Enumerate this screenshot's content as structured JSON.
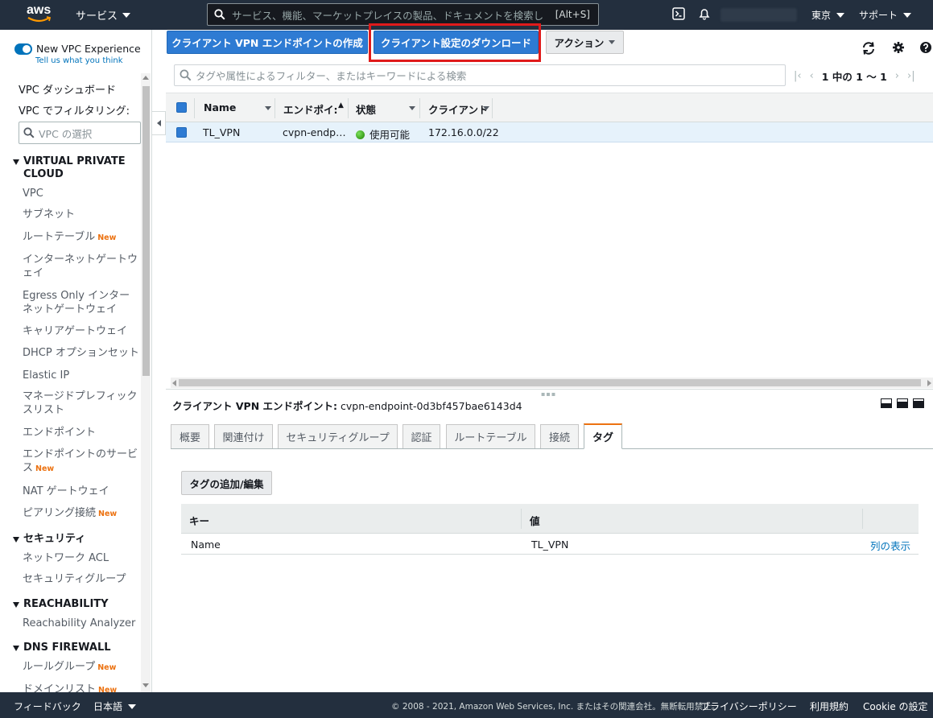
{
  "nav": {
    "logo_text": "aws",
    "services_label": "サービス",
    "search_placeholder": "サービス、機能、マーケットプレイスの製品、ドキュメントを検索し",
    "search_shortcut": "[Alt+S]",
    "region_label": "東京",
    "support_label": "サポート"
  },
  "sidebar": {
    "toggle_label": "New VPC Experience",
    "tell_us": "Tell us what you think",
    "dashboard": "VPC ダッシュボード",
    "filter_label": "VPC でフィルタリング:",
    "vpc_select_placeholder": "VPC の選択",
    "new_badge": "New",
    "sections": {
      "vpc": "VIRTUAL PRIVATE CLOUD",
      "security": "セキュリティ",
      "reachability": "REACHABILITY",
      "dns_firewall": "DNS FIREWALL"
    },
    "items": {
      "vpc": "VPC",
      "subnet": "サブネット",
      "route_table": "ルートテーブル",
      "igw": "インターネットゲートウェイ",
      "egress_only": "Egress Only インターネットゲートウェイ",
      "carrier_gw": "キャリアゲートウェイ",
      "dhcp": "DHCP オプションセット",
      "elastic_ip": "Elastic IP",
      "prefix_list": "マネージドプレフィックスリスト",
      "endpoint": "エンドポイント",
      "endpoint_service": "エンドポイントのサービス",
      "nat_gw": "NAT ゲートウェイ",
      "peering": "ピアリング接続",
      "network_acl": "ネットワーク ACL",
      "security_group": "セキュリティグループ",
      "reachability_analyzer": "Reachability Analyzer",
      "rule_group": "ルールグループ",
      "domain_list": "ドメインリスト"
    }
  },
  "toolbar": {
    "create_label": "クライアント VPN エンドポイントの作成",
    "download_label": "クライアント設定のダウンロード",
    "actions_label": "アクション"
  },
  "filter": {
    "placeholder": "タグや属性によるフィルター、またはキーワードによる検索"
  },
  "pager": {
    "text": "1 中の 1 ～ 1"
  },
  "grid": {
    "columns": [
      "Name",
      "エンドポイ:",
      "状態",
      "クライアント"
    ],
    "row": {
      "name": "TL_VPN",
      "endpoint": "cvpn-endp…",
      "state": "使用可能",
      "client": "172.16.0.0/22"
    }
  },
  "detail": {
    "title_label": "クライアント VPN エンドポイント:",
    "title_value": "cvpn-endpoint-0d3bf457bae6143d4",
    "tabs": [
      "概要",
      "関連付け",
      "セキュリティグループ",
      "認証",
      "ルートテーブル",
      "接続",
      "タグ"
    ],
    "active_tab": "タグ",
    "tag_button": "タグの追加/編集",
    "tag_headers": [
      "キー",
      "値"
    ],
    "tag_row": {
      "key": "Name",
      "value": "TL_VPN"
    },
    "show_columns": "列の表示"
  },
  "footer": {
    "feedback": "フィードバック",
    "language": "日本語",
    "copyright": "© 2008 - 2021, Amazon Web Services, Inc. またはその関連会社。無断転用禁止。",
    "privacy": "プライバシーポリシー",
    "terms": "利用規約",
    "cookie": "Cookie の設定"
  },
  "colors": {
    "nav_bg": "#232f3e",
    "primary": "#2e7bd3",
    "highlight": "#e01b1b",
    "accent_tab": "#ec7211",
    "link": "#0073bb",
    "status_ok": "#1d8102"
  }
}
